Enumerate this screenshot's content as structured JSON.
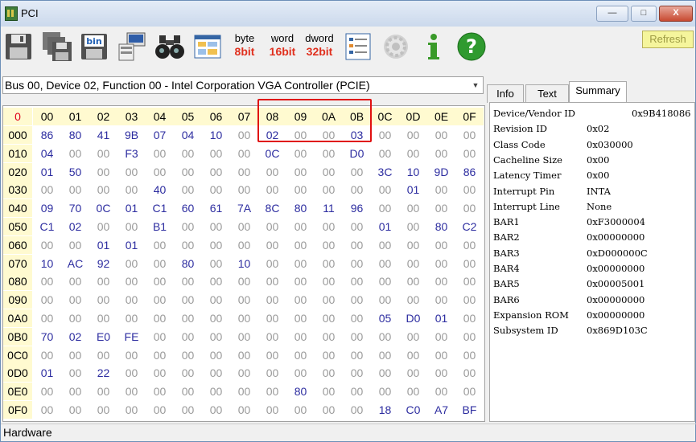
{
  "window": {
    "title": "PCI"
  },
  "controls": {
    "minimize": "—",
    "maximize": "□",
    "close": "X"
  },
  "toolbar": {
    "icons": [
      "save-icon",
      "copy-disks-icon",
      "binary-file-icon",
      "network-pc-icon",
      "binoculars-icon",
      "window-grid-icon",
      "byte-format",
      "word-format",
      "dword-format",
      "list-icon",
      "gear-icon",
      "info-icon",
      "help-icon"
    ],
    "byte_top": "byte",
    "byte_bit": "8bit",
    "word_top": "word",
    "word_bit": "16bit",
    "dword_top": "dword",
    "dword_bit": "32bit",
    "refresh": "Refresh",
    "colors": {
      "byte_bit": "#e0301e",
      "word_bit": "#e0301e",
      "dword_bit": "#e0301e"
    }
  },
  "device_select": {
    "value": "Bus 00, Device 02, Function 00 - Intel Corporation VGA Controller (PCIE)"
  },
  "tabs": [
    {
      "label": "Info"
    },
    {
      "label": "Text"
    },
    {
      "label": "Summary",
      "active": true
    }
  ],
  "summary": [
    {
      "k": "Device/Vendor ID",
      "v": "0x9B418086"
    },
    {
      "k": "Revision ID",
      "v": "0x02"
    },
    {
      "k": "Class Code",
      "v": "0x030000"
    },
    {
      "k": "Cacheline Size",
      "v": "0x00"
    },
    {
      "k": "Latency Timer",
      "v": "0x00"
    },
    {
      "k": "Interrupt Pin",
      "v": "INTA"
    },
    {
      "k": "Interrupt Line",
      "v": "None"
    },
    {
      "k": "BAR1",
      "v": "0xF3000004"
    },
    {
      "k": "BAR2",
      "v": "0x00000000"
    },
    {
      "k": "BAR3",
      "v": "0xD000000C"
    },
    {
      "k": "BAR4",
      "v": "0x00000000"
    },
    {
      "k": "BAR5",
      "v": "0x00005001"
    },
    {
      "k": "BAR6",
      "v": "0x00000000"
    },
    {
      "k": "Expansion ROM",
      "v": "0x00000000"
    },
    {
      "k": "Subsystem ID",
      "v": "0x869D103C"
    }
  ],
  "grid": {
    "corner": "0",
    "columns": [
      "00",
      "01",
      "02",
      "03",
      "04",
      "05",
      "06",
      "07",
      "08",
      "09",
      "0A",
      "0B",
      "0C",
      "0D",
      "0E",
      "0F"
    ],
    "rows": [
      {
        "label": "000",
        "cells": [
          "86",
          "80",
          "41",
          "9B",
          "07",
          "04",
          "10",
          "00",
          "02",
          "00",
          "00",
          "03",
          "00",
          "00",
          "00",
          "00"
        ]
      },
      {
        "label": "010",
        "cells": [
          "04",
          "00",
          "00",
          "F3",
          "00",
          "00",
          "00",
          "00",
          "0C",
          "00",
          "00",
          "D0",
          "00",
          "00",
          "00",
          "00"
        ]
      },
      {
        "label": "020",
        "cells": [
          "01",
          "50",
          "00",
          "00",
          "00",
          "00",
          "00",
          "00",
          "00",
          "00",
          "00",
          "00",
          "3C",
          "10",
          "9D",
          "86"
        ]
      },
      {
        "label": "030",
        "cells": [
          "00",
          "00",
          "00",
          "00",
          "40",
          "00",
          "00",
          "00",
          "00",
          "00",
          "00",
          "00",
          "00",
          "01",
          "00",
          "00"
        ]
      },
      {
        "label": "040",
        "cells": [
          "09",
          "70",
          "0C",
          "01",
          "C1",
          "60",
          "61",
          "7A",
          "8C",
          "80",
          "11",
          "96",
          "00",
          "00",
          "00",
          "00"
        ]
      },
      {
        "label": "050",
        "cells": [
          "C1",
          "02",
          "00",
          "00",
          "B1",
          "00",
          "00",
          "00",
          "00",
          "00",
          "00",
          "00",
          "01",
          "00",
          "80",
          "C2"
        ]
      },
      {
        "label": "060",
        "cells": [
          "00",
          "00",
          "01",
          "01",
          "00",
          "00",
          "00",
          "00",
          "00",
          "00",
          "00",
          "00",
          "00",
          "00",
          "00",
          "00"
        ]
      },
      {
        "label": "070",
        "cells": [
          "10",
          "AC",
          "92",
          "00",
          "00",
          "80",
          "00",
          "10",
          "00",
          "00",
          "00",
          "00",
          "00",
          "00",
          "00",
          "00"
        ]
      },
      {
        "label": "080",
        "cells": [
          "00",
          "00",
          "00",
          "00",
          "00",
          "00",
          "00",
          "00",
          "00",
          "00",
          "00",
          "00",
          "00",
          "00",
          "00",
          "00"
        ]
      },
      {
        "label": "090",
        "cells": [
          "00",
          "00",
          "00",
          "00",
          "00",
          "00",
          "00",
          "00",
          "00",
          "00",
          "00",
          "00",
          "00",
          "00",
          "00",
          "00"
        ]
      },
      {
        "label": "0A0",
        "cells": [
          "00",
          "00",
          "00",
          "00",
          "00",
          "00",
          "00",
          "00",
          "00",
          "00",
          "00",
          "00",
          "05",
          "D0",
          "01",
          "00"
        ]
      },
      {
        "label": "0B0",
        "cells": [
          "70",
          "02",
          "E0",
          "FE",
          "00",
          "00",
          "00",
          "00",
          "00",
          "00",
          "00",
          "00",
          "00",
          "00",
          "00",
          "00"
        ]
      },
      {
        "label": "0C0",
        "cells": [
          "00",
          "00",
          "00",
          "00",
          "00",
          "00",
          "00",
          "00",
          "00",
          "00",
          "00",
          "00",
          "00",
          "00",
          "00",
          "00"
        ]
      },
      {
        "label": "0D0",
        "cells": [
          "01",
          "00",
          "22",
          "00",
          "00",
          "00",
          "00",
          "00",
          "00",
          "00",
          "00",
          "00",
          "00",
          "00",
          "00",
          "00"
        ]
      },
      {
        "label": "0E0",
        "cells": [
          "00",
          "00",
          "00",
          "00",
          "00",
          "00",
          "00",
          "00",
          "00",
          "80",
          "00",
          "00",
          "00",
          "00",
          "00",
          "00"
        ]
      },
      {
        "label": "0F0",
        "cells": [
          "00",
          "00",
          "00",
          "00",
          "00",
          "00",
          "00",
          "00",
          "00",
          "00",
          "00",
          "00",
          "18",
          "C0",
          "A7",
          "BF"
        ]
      }
    ]
  },
  "status": {
    "text": "Hardware"
  }
}
